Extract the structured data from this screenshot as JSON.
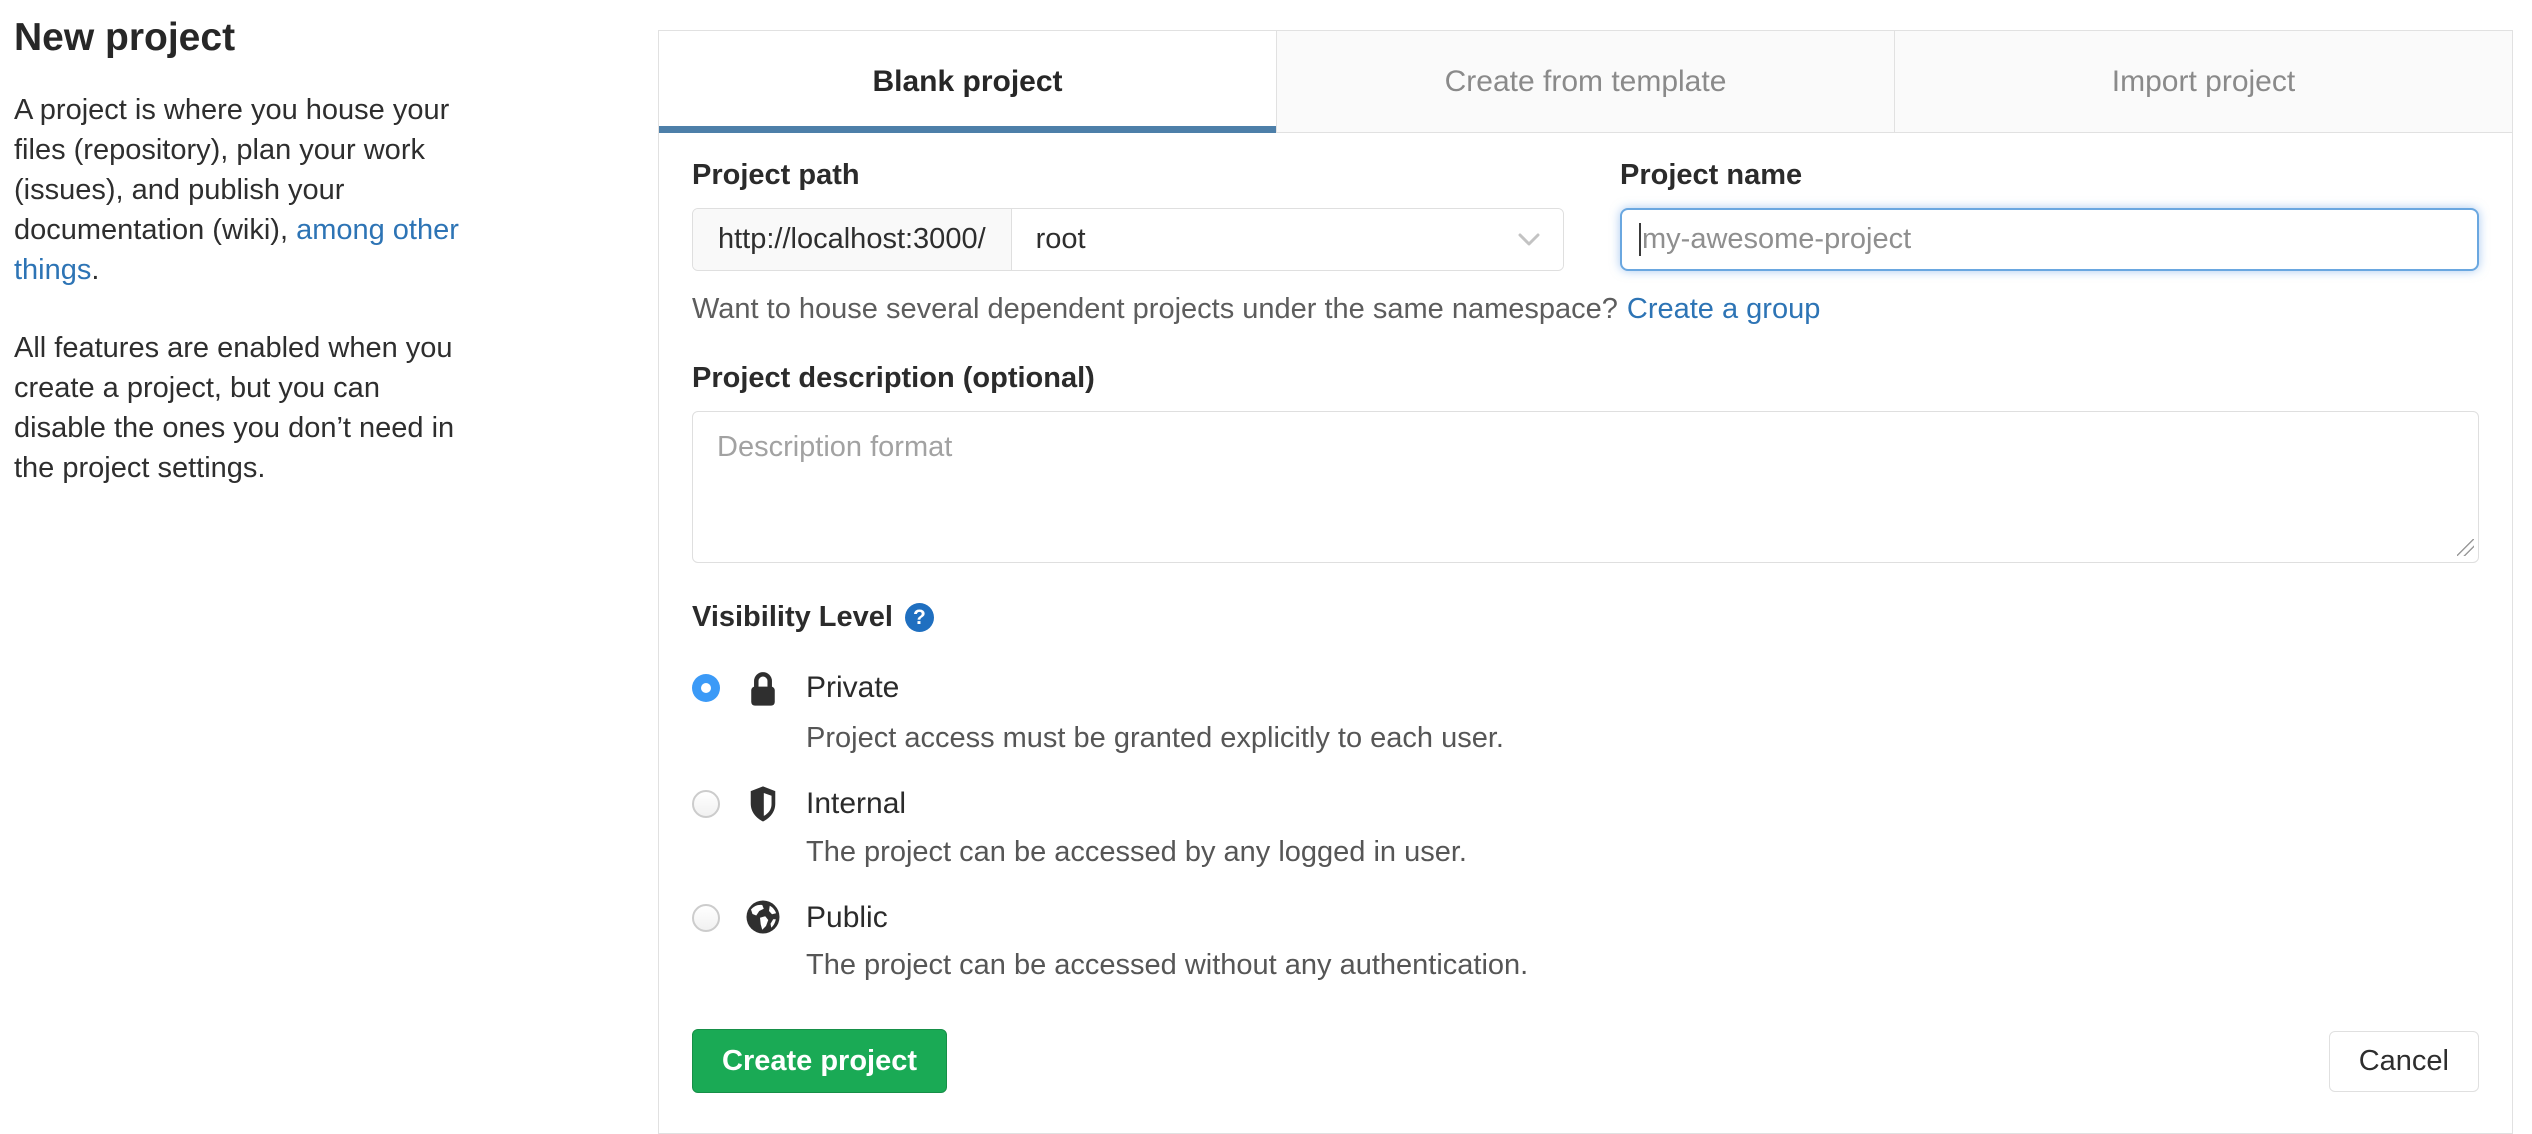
{
  "sidebar": {
    "title": "New project",
    "para1_before": "A project is where you house your files (repository), plan your work (issues), and publish your documentation (wiki), ",
    "para1_link": "among other things",
    "para1_after": ".",
    "para2": "All features are enabled when you create a project, but you can disable the ones you don’t need in the project settings."
  },
  "tabs": [
    {
      "label": "Blank project",
      "active": true
    },
    {
      "label": "Create from template",
      "active": false
    },
    {
      "label": "Import project",
      "active": false
    }
  ],
  "form": {
    "project_path": {
      "label": "Project path",
      "url_prefix": "http://localhost:3000/",
      "namespace_selected": "root"
    },
    "project_name": {
      "label": "Project name",
      "placeholder": "my-awesome-project",
      "value": ""
    },
    "namespace_hint_text": "Want to house several dependent projects under the same namespace?",
    "namespace_hint_link": "Create a group",
    "description": {
      "label": "Project description (optional)",
      "placeholder": "Description format",
      "value": ""
    },
    "visibility": {
      "label": "Visibility Level",
      "help_icon": "question-mark-icon",
      "options": [
        {
          "name": "Private",
          "icon": "lock-icon",
          "selected": true,
          "description": "Project access must be granted explicitly to each user."
        },
        {
          "name": "Internal",
          "icon": "shield-icon",
          "selected": false,
          "description": "The project can be accessed by any logged in user."
        },
        {
          "name": "Public",
          "icon": "globe-icon",
          "selected": false,
          "description": "The project can be accessed without any authentication."
        }
      ]
    },
    "submit_label": "Create project",
    "cancel_label": "Cancel"
  },
  "colors": {
    "accent_green": "#1aaa55",
    "link_blue": "#2d74b5",
    "active_tab_underline": "#4d7fa9",
    "radio_checked_blue": "#3b9af7",
    "help_icon_blue": "#1f6fc0",
    "focus_border_blue": "#6aa7e0"
  }
}
